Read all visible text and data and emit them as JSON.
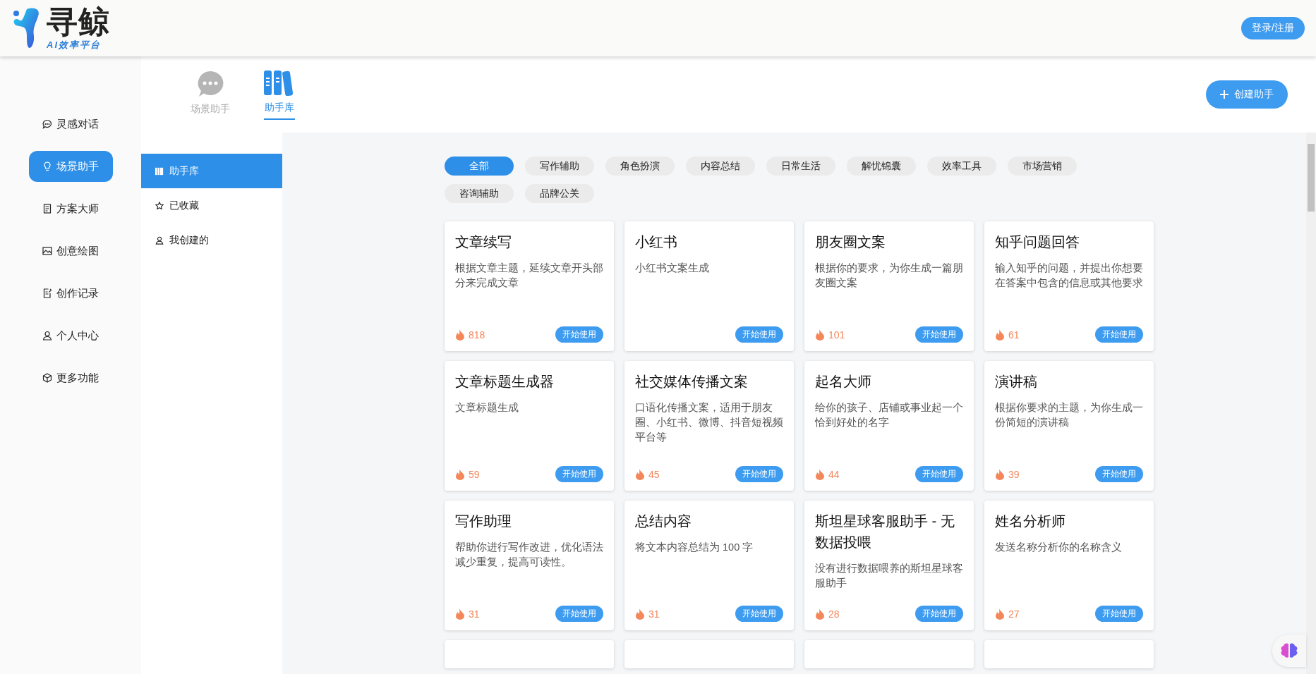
{
  "header": {
    "logo_title": "寻鲸",
    "logo_subtitle": "AI效率平台",
    "login_button": "登录/注册"
  },
  "nav": [
    {
      "label": "灵感对话",
      "kind": "chat",
      "selected": false
    },
    {
      "label": "场景助手",
      "kind": "bulb",
      "selected": true
    },
    {
      "label": "方案大师",
      "kind": "doc",
      "selected": false
    },
    {
      "label": "创意绘图",
      "kind": "image",
      "selected": false
    },
    {
      "label": "创作记录",
      "kind": "edit",
      "selected": false
    },
    {
      "label": "个人中心",
      "kind": "user",
      "selected": false
    },
    {
      "label": "更多功能",
      "kind": "cube",
      "selected": false
    }
  ],
  "tabs": [
    {
      "label": "场景助手",
      "kind": "bubble",
      "selected": false
    },
    {
      "label": "助手库",
      "kind": "books",
      "selected": true
    }
  ],
  "create_button": "创建助手",
  "submenu": [
    {
      "label": "助手库",
      "kind": "library",
      "selected": true
    },
    {
      "label": "已收藏",
      "kind": "star",
      "selected": false
    },
    {
      "label": "我创建的",
      "kind": "user",
      "selected": false
    }
  ],
  "filters": [
    {
      "label": "全部",
      "selected": true
    },
    {
      "label": "写作辅助",
      "selected": false
    },
    {
      "label": "角色扮演",
      "selected": false
    },
    {
      "label": "内容总结",
      "selected": false
    },
    {
      "label": "日常生活",
      "selected": false
    },
    {
      "label": "解忧锦囊",
      "selected": false
    },
    {
      "label": "效率工具",
      "selected": false
    },
    {
      "label": "市场营销",
      "selected": false
    },
    {
      "label": "咨询辅助",
      "selected": false
    },
    {
      "label": "品牌公关",
      "selected": false
    }
  ],
  "cards": [
    {
      "title": "文章续写",
      "description": "根据文章主题，延续文章开头部分来完成文章",
      "count": "818",
      "button": "开始使用"
    },
    {
      "title": "小红书",
      "description": "小红书文案生成",
      "button": "开始使用"
    },
    {
      "title": "朋友圈文案",
      "description": "根据你的要求，为你生成一篇朋友圈文案",
      "count": "101",
      "button": "开始使用"
    },
    {
      "title": "知乎问题回答",
      "description": "输入知乎的问题，并提出你想要在答案中包含的信息或其他要求",
      "count": "61",
      "button": "开始使用"
    },
    {
      "title": "文章标题生成器",
      "description": "文章标题生成",
      "count": "59",
      "button": "开始使用"
    },
    {
      "title": "社交媒体传播文案",
      "description": "口语化传播文案，适用于朋友圈、小红书、微博、抖音短视频平台等",
      "count": "45",
      "button": "开始使用"
    },
    {
      "title": "起名大师",
      "description": "给你的孩子、店铺或事业起一个恰到好处的名字",
      "count": "44",
      "button": "开始使用"
    },
    {
      "title": "演讲稿",
      "description": "根据你要求的主题，为你生成一份简短的演讲稿",
      "count": "39",
      "button": "开始使用"
    },
    {
      "title": "写作助理",
      "description": "帮助你进行写作改进，优化语法减少重复，提高可读性。",
      "count": "31",
      "button": "开始使用"
    },
    {
      "title": "总结内容",
      "description": "将文本内容总结为 100 字",
      "count": "31",
      "button": "开始使用"
    },
    {
      "title": "斯坦星球客服助手 - 无数据投喂",
      "description": "没有进行数据喂养的斯坦星球客服助手",
      "count": "28",
      "button": "开始使用"
    },
    {
      "title": "姓名分析师",
      "description": "发送名称分析你的名称含义",
      "count": "27",
      "button": "开始使用"
    }
  ]
}
